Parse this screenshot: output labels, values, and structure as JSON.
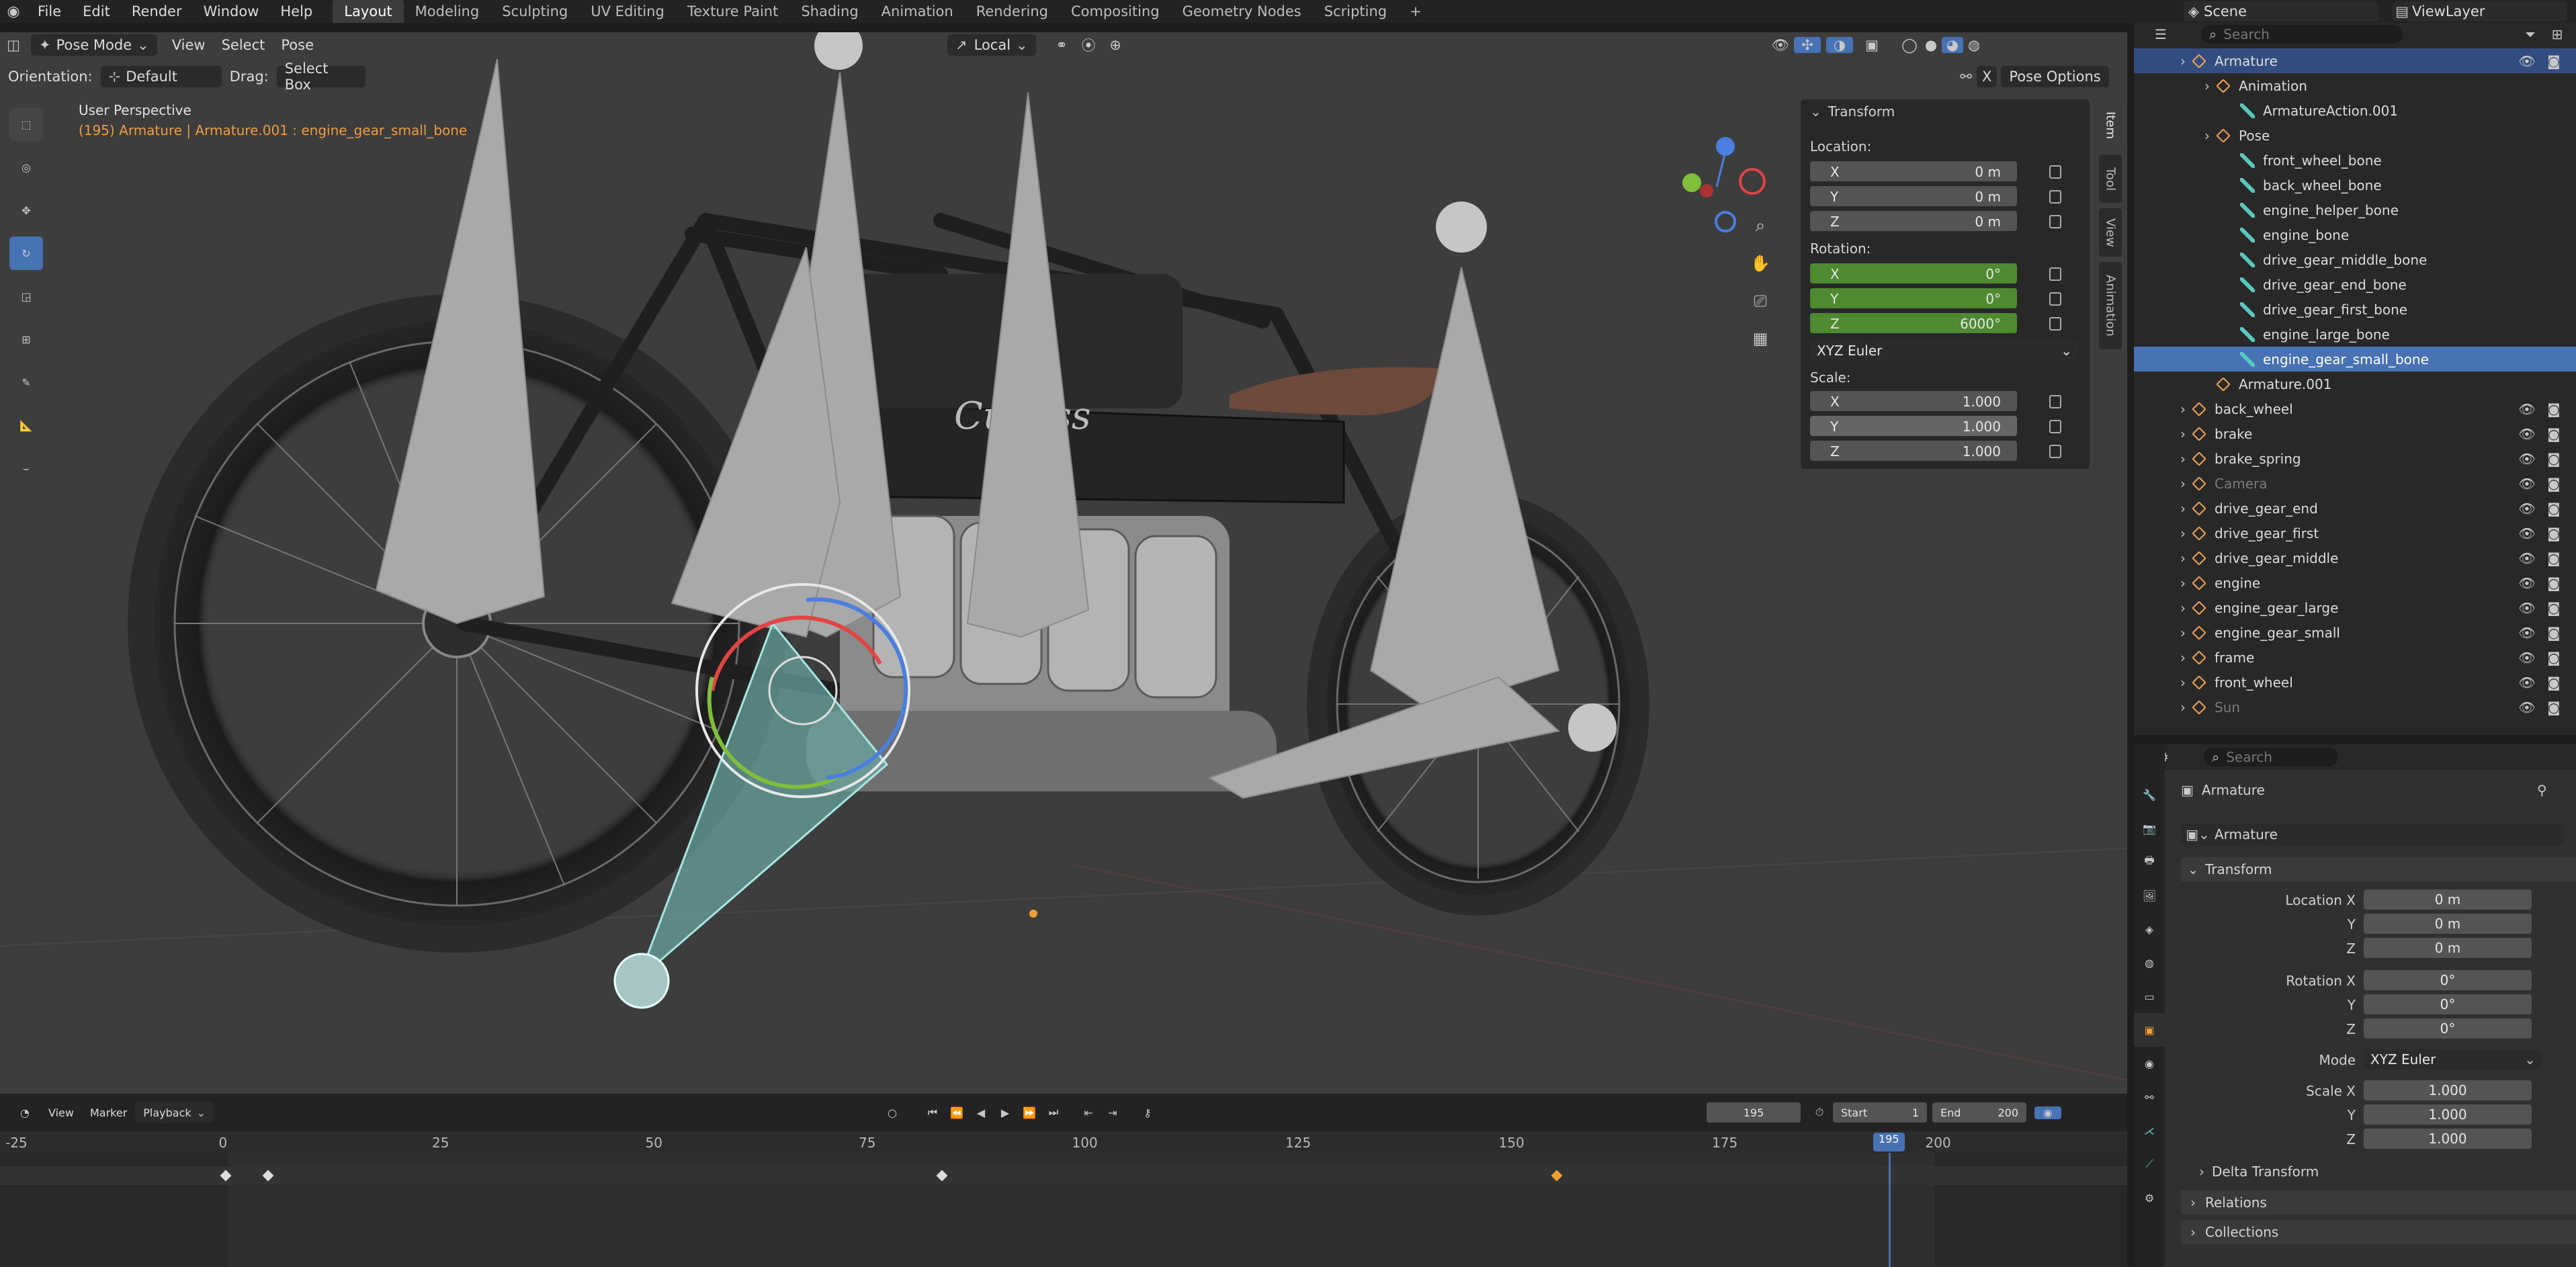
{
  "topbar": {
    "menu": [
      "File",
      "Edit",
      "Render",
      "Window",
      "Help"
    ],
    "workspaces": [
      "Layout",
      "Modeling",
      "Sculpting",
      "UV Editing",
      "Texture Paint",
      "Shading",
      "Animation",
      "Rendering",
      "Compositing",
      "Geometry Nodes",
      "Scripting"
    ],
    "active_workspace": "Layout",
    "scene": "Scene",
    "view_layer": "ViewLayer"
  },
  "viewport_header": {
    "mode": "Pose Mode",
    "menus": [
      "View",
      "Select",
      "Pose"
    ],
    "transform_space": "Local",
    "orientation_label": "Orientation:",
    "orientation_value": "Default",
    "drag_label": "Drag:",
    "drag_value": "Select Box",
    "pose_options": "Pose Options",
    "x_toggle": "X"
  },
  "viewport": {
    "view_name": "User Perspective",
    "context_text": "(195) Armature | Armature.001 : engine_gear_small_bone",
    "nav_gizmo": {
      "x": "X",
      "y": "Y",
      "z": "Z"
    }
  },
  "side_tabs": [
    "Item",
    "Tool",
    "View",
    "Animation"
  ],
  "transform_panel": {
    "title": "Transform",
    "location_label": "Location:",
    "location": [
      {
        "axis": "X",
        "value": "0 m"
      },
      {
        "axis": "Y",
        "value": "0 m"
      },
      {
        "axis": "Z",
        "value": "0 m"
      }
    ],
    "rotation_label": "Rotation:",
    "rotation": [
      {
        "axis": "X",
        "value": "0°"
      },
      {
        "axis": "Y",
        "value": "0°"
      },
      {
        "axis": "Z",
        "value": "6000°"
      }
    ],
    "rotation_mode": "XYZ Euler",
    "scale_label": "Scale:",
    "scale": [
      {
        "axis": "X",
        "value": "1.000"
      },
      {
        "axis": "Y",
        "value": "1.000"
      },
      {
        "axis": "Z",
        "value": "1.000"
      }
    ]
  },
  "outliner": {
    "search_placeholder": "Search",
    "rows": [
      {
        "label": "Armature",
        "indent": 0,
        "state": "sel"
      },
      {
        "label": "Animation",
        "indent": 1,
        "state": ""
      },
      {
        "label": "ArmatureAction.001",
        "indent": 2,
        "state": ""
      },
      {
        "label": "Pose",
        "indent": 1,
        "state": ""
      },
      {
        "label": "front_wheel_bone",
        "indent": 2,
        "state": ""
      },
      {
        "label": "back_wheel_bone",
        "indent": 2,
        "state": ""
      },
      {
        "label": "engine_helper_bone",
        "indent": 2,
        "state": ""
      },
      {
        "label": "engine_bone",
        "indent": 2,
        "state": ""
      },
      {
        "label": "drive_gear_middle_bone",
        "indent": 2,
        "state": ""
      },
      {
        "label": "drive_gear_end_bone",
        "indent": 2,
        "state": ""
      },
      {
        "label": "drive_gear_first_bone",
        "indent": 2,
        "state": ""
      },
      {
        "label": "engine_large_bone",
        "indent": 2,
        "state": ""
      },
      {
        "label": "engine_gear_small_bone",
        "indent": 2,
        "state": "hl"
      },
      {
        "label": "Armature.001",
        "indent": 1,
        "state": ""
      },
      {
        "label": "back_wheel",
        "indent": 0,
        "state": ""
      },
      {
        "label": "brake",
        "indent": 0,
        "state": ""
      },
      {
        "label": "brake_spring",
        "indent": 0,
        "state": ""
      },
      {
        "label": "Camera",
        "indent": 0,
        "state": "dim"
      },
      {
        "label": "drive_gear_end",
        "indent": 0,
        "state": ""
      },
      {
        "label": "drive_gear_first",
        "indent": 0,
        "state": ""
      },
      {
        "label": "drive_gear_middle",
        "indent": 0,
        "state": ""
      },
      {
        "label": "engine",
        "indent": 0,
        "state": ""
      },
      {
        "label": "engine_gear_large",
        "indent": 0,
        "state": ""
      },
      {
        "label": "engine_gear_small",
        "indent": 0,
        "state": ""
      },
      {
        "label": "frame",
        "indent": 0,
        "state": ""
      },
      {
        "label": "front_wheel",
        "indent": 0,
        "state": ""
      },
      {
        "label": "Sun",
        "indent": 0,
        "state": "dim"
      }
    ]
  },
  "properties": {
    "search_placeholder": "Search",
    "object_name": "Armature",
    "object_field": "Armature",
    "transform_title": "Transform",
    "location_x_label": "Location X",
    "rotation_x_label": "Rotation X",
    "scale_x_label": "Scale X",
    "y_label": "Y",
    "z_label": "Z",
    "mode_label": "Mode",
    "location": [
      "0 m",
      "0 m",
      "0 m"
    ],
    "rotation": [
      "0°",
      "0°",
      "0°"
    ],
    "mode": "XYZ Euler",
    "scale": [
      "1.000",
      "1.000",
      "1.000"
    ],
    "delta_transform": "Delta Transform",
    "relations": "Relations",
    "collections": "Collections"
  },
  "timeline": {
    "menus": [
      "View",
      "Marker",
      "Playback"
    ],
    "current_frame": "195",
    "start_label": "Start",
    "start": "1",
    "end_label": "End",
    "end": "200",
    "ruler": [
      "-25",
      "0",
      "25",
      "50",
      "75",
      "100",
      "125",
      "150",
      "175",
      "200"
    ],
    "playhead": "195",
    "keyframes": [
      0,
      5,
      84,
      156
    ]
  }
}
